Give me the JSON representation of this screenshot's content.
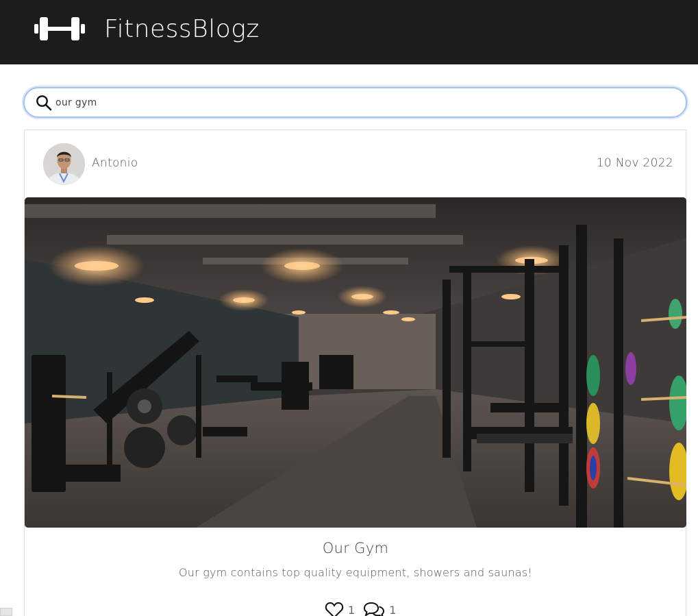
{
  "header": {
    "brand": "FitnessBlogz",
    "logo_icon": "dumbbell-icon"
  },
  "search": {
    "value": "our gym",
    "icon": "search-icon"
  },
  "post": {
    "author": "Antonio",
    "date": "10 Nov 2022",
    "title": "Our Gym",
    "excerpt": "Our gym contains top quality equipment, showers and saunas!",
    "likes": "1",
    "comments": "1"
  },
  "colors": {
    "navbar": "#1c1c1c",
    "search_border": "#a7c3ea"
  }
}
